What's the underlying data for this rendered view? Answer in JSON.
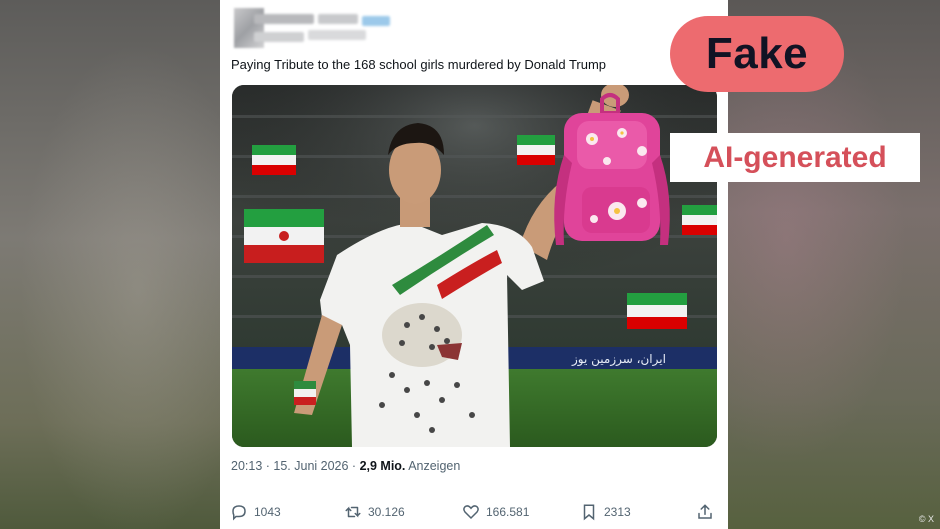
{
  "tweet": {
    "text": "Paying Tribute to the 168 school girls murdered by Donald Trump",
    "time": "20:13 · 15. Juni 2026 · ",
    "views": "2,9 Mio.",
    "views_label": " Anzeigen"
  },
  "actions": {
    "reply_count": "1043",
    "retweet_count": "30.126",
    "like_count": "166.581",
    "bookmark_count": "2313"
  },
  "overlays": {
    "fake_label": "Fake",
    "ai_label": "AI-generated",
    "credit": "© X"
  },
  "image": {
    "banner_text": "ایران، سرزمین یوز"
  },
  "colors": {
    "fake_badge": "#ed6b6f",
    "fake_text": "#111324",
    "ai_text": "#d5505a",
    "backpack": "#e0449a"
  }
}
